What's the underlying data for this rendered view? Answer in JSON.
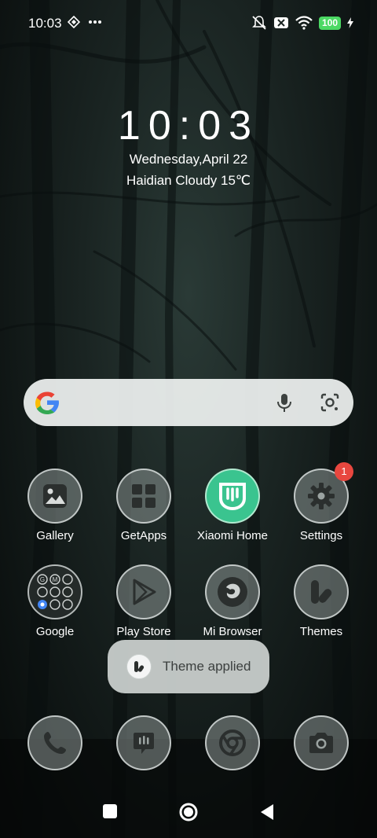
{
  "status_bar": {
    "time": "10:03",
    "left_icons": [
      "diamond-icon",
      "more-dots-icon"
    ],
    "right_icons": [
      "silent-mode-icon",
      "sim-x-icon",
      "wifi-icon",
      "battery-icon",
      "charging-icon"
    ],
    "battery_level": "100"
  },
  "clock_widget": {
    "time": "10:03",
    "date": "Wednesday,April 22",
    "weather": "Haidian Cloudy 15℃"
  },
  "search_bar": {
    "logo": "google-g-icon",
    "mic": "mic-icon",
    "lens": "lens-icon"
  },
  "apps_row1": [
    {
      "label": "Gallery",
      "icon": "gallery-icon"
    },
    {
      "label": "GetApps",
      "icon": "getapps-icon"
    },
    {
      "label": "Xiaomi Home",
      "icon": "xiaomi-home-icon"
    },
    {
      "label": "Settings",
      "icon": "gear-icon",
      "badge": "1"
    }
  ],
  "apps_row2": [
    {
      "label": "Google",
      "icon": "google-folder-icon"
    },
    {
      "label": "Play Store",
      "icon": "play-store-icon"
    },
    {
      "label": "Mi Browser",
      "icon": "mi-browser-icon"
    },
    {
      "label": "Themes",
      "icon": "themes-icon"
    }
  ],
  "dock": [
    {
      "icon": "phone-icon"
    },
    {
      "icon": "messages-icon"
    },
    {
      "icon": "chrome-icon"
    },
    {
      "icon": "camera-icon"
    }
  ],
  "toast": {
    "text": "Theme applied",
    "icon": "themes-icon"
  },
  "nav_bar": {
    "buttons": [
      "recents-button",
      "home-button",
      "back-button"
    ]
  },
  "colors": {
    "accent_green": "#3ac48f",
    "badge_red": "#e8473f",
    "battery_green": "#4cd964"
  }
}
